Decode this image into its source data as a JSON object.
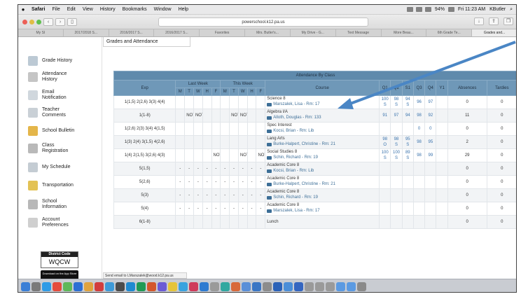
{
  "menubar": {
    "apple": "",
    "items": [
      "Safari",
      "File",
      "Edit",
      "View",
      "History",
      "Bookmarks",
      "Window",
      "Help"
    ],
    "right": [
      "94%",
      "Fri 11:23 AM",
      "KButler"
    ]
  },
  "browser": {
    "url": "powerschool.k12.pa.us",
    "tabs": [
      "My SI",
      "2017/2018 S...",
      "2016/2017 S...",
      "2016/2017 S...",
      "Favorites",
      "Mrs. Butler's...",
      "My Drive - G...",
      "Text Message",
      "More Beau...",
      "6th Grade Te...",
      "Grades and..."
    ]
  },
  "sidebar": {
    "items": [
      "Grade History",
      "Attendance History",
      "Email Notification",
      "Teacher Comments",
      "School Bulletin",
      "Class Registration",
      "My Schedule",
      "Transportation",
      "School Information",
      "Account Preferences"
    ],
    "district_code_title": "District Code",
    "district_code": "WQCW",
    "download_label": "Download on the App Store"
  },
  "status_bar": "Send email to LMarszalek@wood.k12.pa.us",
  "content": {
    "tab": "Grades and Attendance",
    "table_title": "Attendance By Class",
    "headers": {
      "exp": "Exp",
      "last_week": "Last Week",
      "this_week": "This Week",
      "days": [
        "M",
        "T",
        "W",
        "H",
        "F",
        "M",
        "T",
        "W",
        "H",
        "F"
      ],
      "course": "Course",
      "terms": [
        "Q1",
        "Q2",
        "S1",
        "Q3",
        "Q4",
        "Y1"
      ],
      "absences": "Absences",
      "tardies": "Tardies"
    },
    "rows": [
      {
        "exp": "1(1,5) 2(2,6) 3(3) 4(4)",
        "days": [
          "",
          "",
          "",
          "",
          "",
          "",
          "",
          "",
          "",
          ""
        ],
        "course": "Science 8",
        "teacher": "Marszalek, Lisa - Rm: 17",
        "terms": [
          "100\nS",
          "98\nS",
          "94\nS",
          "96",
          "97",
          ""
        ],
        "absences": "0",
        "tardies": "0"
      },
      {
        "exp": "1(1-8)",
        "days": [
          "",
          "NOT",
          "NOT",
          "",
          "",
          "",
          "NOT",
          "NOT",
          "",
          ""
        ],
        "course": "Algebra I/A",
        "teacher": "Alloth, Douglas - Rm: 133",
        "terms": [
          "91",
          "97",
          "94",
          "98",
          "92",
          ""
        ],
        "absences": "11",
        "tardies": "0"
      },
      {
        "exp": "1(2,6) 2(3) 3(4) 4(1,5)",
        "days": [
          "",
          "",
          "",
          "",
          "",
          "",
          "",
          "",
          "",
          ""
        ],
        "course": "Spec Interest",
        "teacher": "Kocsi, Brian - Rm: Lib",
        "terms": [
          "",
          "",
          "",
          "0",
          "0",
          ""
        ],
        "absences": "0",
        "tardies": "0"
      },
      {
        "exp": "1(3) 2(4) 3(1,5) 4(2,6)",
        "days": [
          "",
          "",
          "",
          "",
          "",
          "",
          "",
          "",
          "",
          ""
        ],
        "course": "Lang Arts",
        "teacher": "Burke-Halpert, Christine - Rm: 21",
        "terms": [
          "98\nO",
          "98\nS",
          "95\nS",
          "98",
          "95",
          ""
        ],
        "absences": "2",
        "tardies": "0"
      },
      {
        "exp": "1(4) 2(1,5) 3(2,6) 4(3)",
        "days": [
          "",
          "",
          "",
          "",
          "NOT",
          "",
          "",
          "NOT",
          "",
          "NOT"
        ],
        "course": "Social Studies 8",
        "teacher": "Schin, Richard - Rm: 19",
        "terms": [
          "100\nS",
          "100\nS",
          "89\nS",
          "98",
          "99",
          ""
        ],
        "absences": "29",
        "tardies": "0"
      },
      {
        "exp": "5(1,5)",
        "days": [
          "-",
          "-",
          "-",
          "-",
          "-",
          "-",
          "-",
          "-",
          "-",
          "-"
        ],
        "course": "Academic Core 8",
        "teacher": "Kocsi, Brian - Rm: Lib",
        "terms": [
          "",
          "",
          "",
          "",
          "",
          ""
        ],
        "absences": "0",
        "tardies": "0"
      },
      {
        "exp": "5(2,6)",
        "days": [
          "-",
          "-",
          "-",
          "-",
          "-",
          "-",
          "-",
          "-",
          "-",
          "-"
        ],
        "course": "Academic Core 8",
        "teacher": "Burke-Halpert, Christine - Rm: 21",
        "terms": [
          "",
          "",
          "",
          "",
          "",
          ""
        ],
        "absences": "0",
        "tardies": "0"
      },
      {
        "exp": "5(3)",
        "days": [
          "-",
          "-",
          "-",
          "-",
          "-",
          "-",
          "-",
          "-",
          "-",
          "-"
        ],
        "course": "Academic Core 8",
        "teacher": "Schin, Richard - Rm: 19",
        "terms": [
          "",
          "",
          "",
          "",
          "",
          ""
        ],
        "absences": "0",
        "tardies": "0"
      },
      {
        "exp": "5(4)",
        "days": [
          "-",
          "-",
          "-",
          "-",
          "-",
          "-",
          "-",
          "-",
          "-",
          "-"
        ],
        "course": "Academic Core 8",
        "teacher": "Marszalek, Lisa - Rm: 17",
        "terms": [
          "",
          "",
          "",
          "",
          "",
          ""
        ],
        "absences": "0",
        "tardies": "0"
      },
      {
        "exp": "6(1-8)",
        "days": [
          "",
          "",
          "",
          "",
          "",
          "",
          "",
          "",
          "",
          ""
        ],
        "course": "Lunch",
        "teacher": "",
        "terms": [
          "",
          "",
          "",
          "",
          "",
          ""
        ],
        "absences": "0",
        "tardies": "0"
      }
    ]
  },
  "colors": {
    "header_blue": "#6f98b8",
    "annotation_arrow": "#4a86c5",
    "link_blue": "#3e6f98"
  }
}
